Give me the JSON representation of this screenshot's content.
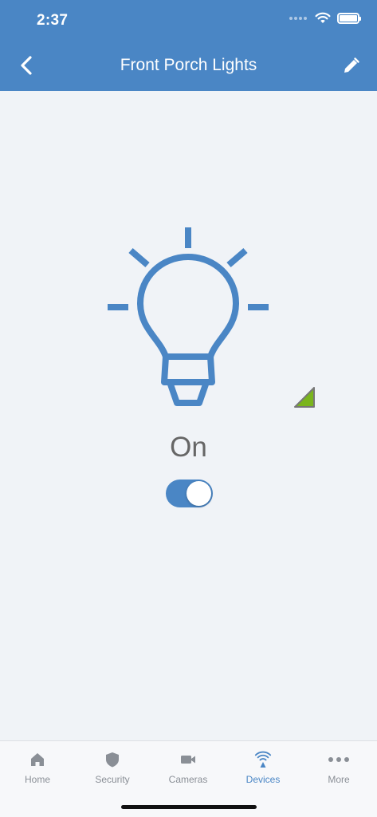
{
  "status_bar": {
    "time": "2:37"
  },
  "header": {
    "title": "Front Porch Lights",
    "back_icon": "chevron-left-icon",
    "edit_icon": "pencil-icon"
  },
  "device": {
    "state_label": "On",
    "is_on": true,
    "icon": "lightbulb-icon"
  },
  "tabs": [
    {
      "label": "Home",
      "icon": "house-icon",
      "active": false
    },
    {
      "label": "Security",
      "icon": "shield-icon",
      "active": false
    },
    {
      "label": "Cameras",
      "icon": "video-camera-icon",
      "active": false
    },
    {
      "label": "Devices",
      "icon": "wireless-signal-icon",
      "active": true
    },
    {
      "label": "More",
      "icon": "ellipsis-icon",
      "active": false
    }
  ],
  "colors": {
    "accent": "#4a86c5",
    "background": "#f0f3f7",
    "signal_indicator": "#7ab51d",
    "inactive_tab": "#8a8f96"
  }
}
